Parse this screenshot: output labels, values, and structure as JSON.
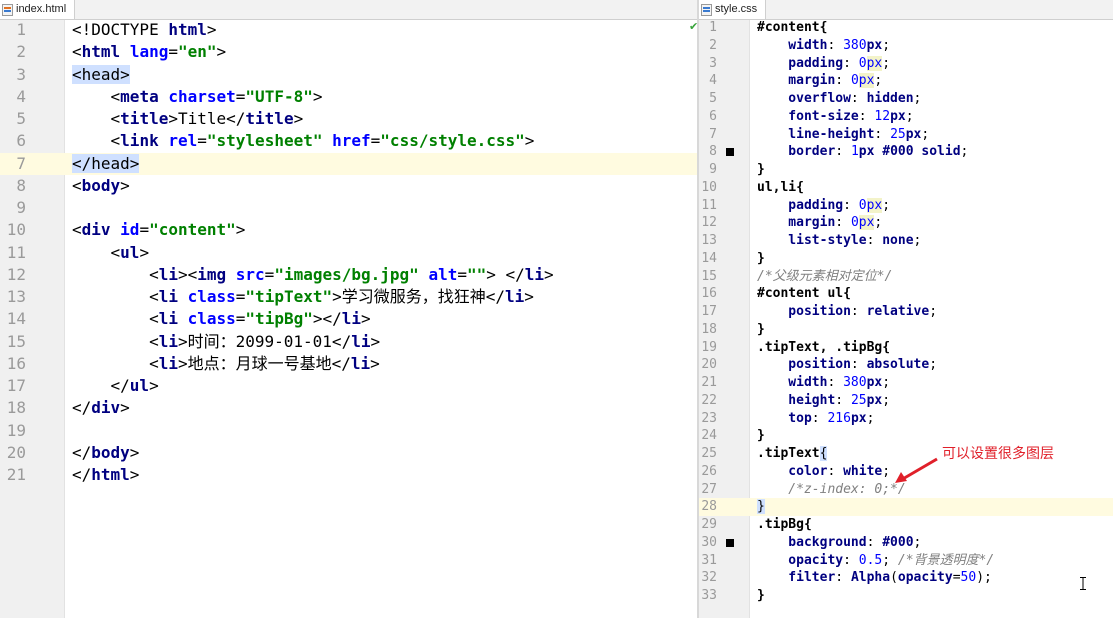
{
  "left": {
    "tab": "index.html",
    "lines": [
      {
        "n": "1",
        "s": [
          [
            "tx",
            "<!DOCTYPE "
          ],
          [
            "t",
            "html"
          ],
          [
            "tx",
            ">"
          ]
        ]
      },
      {
        "n": "2",
        "s": [
          [
            "tx",
            "<"
          ],
          [
            "t",
            "html "
          ],
          [
            "a",
            "lang"
          ],
          [
            "tx",
            "="
          ],
          [
            "v",
            "\"en\""
          ],
          [
            "tx",
            ">"
          ]
        ]
      },
      {
        "n": "3",
        "s": [
          [
            "hlt",
            "<head>"
          ]
        ]
      },
      {
        "n": "4",
        "s": [
          [
            "tx",
            "    <"
          ],
          [
            "t",
            "meta "
          ],
          [
            "a",
            "charset"
          ],
          [
            "tx",
            "="
          ],
          [
            "v",
            "\"UTF-8\""
          ],
          [
            "tx",
            ">"
          ]
        ]
      },
      {
        "n": "5",
        "s": [
          [
            "tx",
            "    <"
          ],
          [
            "t",
            "title"
          ],
          [
            "tx",
            ">Title</"
          ],
          [
            "t",
            "title"
          ],
          [
            "tx",
            ">"
          ]
        ]
      },
      {
        "n": "6",
        "s": [
          [
            "tx",
            "    <"
          ],
          [
            "t",
            "link "
          ],
          [
            "a",
            "rel"
          ],
          [
            "tx",
            "="
          ],
          [
            "v",
            "\"stylesheet\" "
          ],
          [
            "a",
            "href"
          ],
          [
            "tx",
            "="
          ],
          [
            "v",
            "\"css/style.css\""
          ],
          [
            "tx",
            ">"
          ]
        ]
      },
      {
        "n": "7",
        "s": [
          [
            "hlt",
            "</head>"
          ]
        ]
      },
      {
        "n": "8",
        "s": [
          [
            "tx",
            "<"
          ],
          [
            "t",
            "body"
          ],
          [
            "tx",
            ">"
          ]
        ]
      },
      {
        "n": "9",
        "s": []
      },
      {
        "n": "10",
        "s": [
          [
            "tx",
            "<"
          ],
          [
            "t",
            "div "
          ],
          [
            "a",
            "id"
          ],
          [
            "tx",
            "="
          ],
          [
            "v",
            "\"content\""
          ],
          [
            "tx",
            ">"
          ]
        ]
      },
      {
        "n": "11",
        "s": [
          [
            "tx",
            "    <"
          ],
          [
            "t",
            "ul"
          ],
          [
            "tx",
            ">"
          ]
        ]
      },
      {
        "n": "12",
        "s": [
          [
            "tx",
            "        <"
          ],
          [
            "t",
            "li"
          ],
          [
            "tx",
            "><"
          ],
          [
            "t",
            "img "
          ],
          [
            "a",
            "src"
          ],
          [
            "tx",
            "="
          ],
          [
            "v",
            "\"images/bg.jpg\" "
          ],
          [
            "a",
            "alt"
          ],
          [
            "tx",
            "="
          ],
          [
            "v",
            "\"\""
          ],
          [
            "tx",
            "> </"
          ],
          [
            "t",
            "li"
          ],
          [
            "tx",
            ">"
          ]
        ]
      },
      {
        "n": "13",
        "s": [
          [
            "tx",
            "        <"
          ],
          [
            "t",
            "li "
          ],
          [
            "a",
            "class"
          ],
          [
            "tx",
            "="
          ],
          [
            "v",
            "\"tipText\""
          ],
          [
            "tx",
            ">学习微服务，找狂神</"
          ],
          [
            "t",
            "li"
          ],
          [
            "tx",
            ">"
          ]
        ]
      },
      {
        "n": "14",
        "s": [
          [
            "tx",
            "        <"
          ],
          [
            "t",
            "li "
          ],
          [
            "a",
            "class"
          ],
          [
            "tx",
            "="
          ],
          [
            "v",
            "\"tipBg\""
          ],
          [
            "tx",
            "></"
          ],
          [
            "t",
            "li"
          ],
          [
            "tx",
            ">"
          ]
        ]
      },
      {
        "n": "15",
        "s": [
          [
            "tx",
            "        <"
          ],
          [
            "t",
            "li"
          ],
          [
            "tx",
            ">时间：2099-01-01</"
          ],
          [
            "t",
            "li"
          ],
          [
            "tx",
            ">"
          ]
        ]
      },
      {
        "n": "16",
        "s": [
          [
            "tx",
            "        <"
          ],
          [
            "t",
            "li"
          ],
          [
            "tx",
            ">地点：月球一号基地</"
          ],
          [
            "t",
            "li"
          ],
          [
            "tx",
            ">"
          ]
        ]
      },
      {
        "n": "17",
        "s": [
          [
            "tx",
            "    </"
          ],
          [
            "t",
            "ul"
          ],
          [
            "tx",
            ">"
          ]
        ]
      },
      {
        "n": "18",
        "s": [
          [
            "tx",
            "</"
          ],
          [
            "t",
            "div"
          ],
          [
            "tx",
            ">"
          ]
        ]
      },
      {
        "n": "19",
        "s": []
      },
      {
        "n": "20",
        "s": [
          [
            "tx",
            "</"
          ],
          [
            "t",
            "body"
          ],
          [
            "tx",
            ">"
          ]
        ]
      },
      {
        "n": "21",
        "s": [
          [
            "tx",
            "</"
          ],
          [
            "t",
            "html"
          ],
          [
            "tx",
            ">"
          ]
        ]
      }
    ]
  },
  "right": {
    "tab": "style.css",
    "lines": [
      {
        "n": "1",
        "s": [
          [
            "sel",
            "#content{"
          ]
        ]
      },
      {
        "n": "2",
        "s": [
          [
            "p",
            "    width"
          ],
          [
            "tx",
            ": "
          ],
          [
            "u",
            "380"
          ],
          [
            "p",
            "px"
          ],
          [
            "tx",
            ";"
          ]
        ]
      },
      {
        "n": "3",
        "s": [
          [
            "p",
            "    padding"
          ],
          [
            "tx",
            ": "
          ],
          [
            "u",
            "0"
          ],
          [
            "px",
            "px"
          ],
          [
            "tx",
            ";"
          ]
        ]
      },
      {
        "n": "4",
        "s": [
          [
            "p",
            "    margin"
          ],
          [
            "tx",
            ": "
          ],
          [
            "u",
            "0"
          ],
          [
            "px",
            "px"
          ],
          [
            "tx",
            ";"
          ]
        ]
      },
      {
        "n": "5",
        "s": [
          [
            "p",
            "    overflow"
          ],
          [
            "tx",
            ": "
          ],
          [
            "val",
            "hidden"
          ],
          [
            "tx",
            ";"
          ]
        ]
      },
      {
        "n": "6",
        "s": [
          [
            "p",
            "    font-size"
          ],
          [
            "tx",
            ": "
          ],
          [
            "u",
            "12"
          ],
          [
            "p",
            "px"
          ],
          [
            "tx",
            ";"
          ]
        ]
      },
      {
        "n": "7",
        "s": [
          [
            "p",
            "    line-height"
          ],
          [
            "tx",
            ": "
          ],
          [
            "u",
            "25"
          ],
          [
            "p",
            "px"
          ],
          [
            "tx",
            ";"
          ]
        ]
      },
      {
        "n": "8",
        "s": [
          [
            "p",
            "    border"
          ],
          [
            "tx",
            ": "
          ],
          [
            "u",
            "1"
          ],
          [
            "p",
            "px "
          ],
          [
            "val",
            "#000 solid"
          ],
          [
            "tx",
            ";"
          ]
        ]
      },
      {
        "n": "9",
        "s": [
          [
            "sel",
            "}"
          ]
        ]
      },
      {
        "n": "10",
        "s": [
          [
            "sel",
            "ul,li{"
          ]
        ]
      },
      {
        "n": "11",
        "s": [
          [
            "p",
            "    padding"
          ],
          [
            "tx",
            ": "
          ],
          [
            "u",
            "0"
          ],
          [
            "px",
            "px"
          ],
          [
            "tx",
            ";"
          ]
        ]
      },
      {
        "n": "12",
        "s": [
          [
            "p",
            "    margin"
          ],
          [
            "tx",
            ": "
          ],
          [
            "u",
            "0"
          ],
          [
            "px",
            "px"
          ],
          [
            "tx",
            ";"
          ]
        ]
      },
      {
        "n": "13",
        "s": [
          [
            "p",
            "    list-style"
          ],
          [
            "tx",
            ": "
          ],
          [
            "val",
            "none"
          ],
          [
            "tx",
            ";"
          ]
        ]
      },
      {
        "n": "14",
        "s": [
          [
            "sel",
            "}"
          ]
        ]
      },
      {
        "n": "15",
        "s": [
          [
            "cm",
            "/*父级元素相对定位*/"
          ]
        ]
      },
      {
        "n": "16",
        "s": [
          [
            "sel",
            "#content ul{"
          ]
        ]
      },
      {
        "n": "17",
        "s": [
          [
            "p",
            "    position"
          ],
          [
            "tx",
            ": "
          ],
          [
            "val",
            "relative"
          ],
          [
            "tx",
            ";"
          ]
        ]
      },
      {
        "n": "18",
        "s": [
          [
            "sel",
            "}"
          ]
        ]
      },
      {
        "n": "19",
        "s": [
          [
            "sel",
            ".tipText, .tipBg{"
          ]
        ]
      },
      {
        "n": "20",
        "s": [
          [
            "p",
            "    position"
          ],
          [
            "tx",
            ": "
          ],
          [
            "val",
            "absolute"
          ],
          [
            "tx",
            ";"
          ]
        ]
      },
      {
        "n": "21",
        "s": [
          [
            "p",
            "    width"
          ],
          [
            "tx",
            ": "
          ],
          [
            "u",
            "380"
          ],
          [
            "p",
            "px"
          ],
          [
            "tx",
            ";"
          ]
        ]
      },
      {
        "n": "22",
        "s": [
          [
            "p",
            "    height"
          ],
          [
            "tx",
            ": "
          ],
          [
            "u",
            "25"
          ],
          [
            "p",
            "px"
          ],
          [
            "tx",
            ";"
          ]
        ]
      },
      {
        "n": "23",
        "s": [
          [
            "p",
            "    top"
          ],
          [
            "tx",
            ": "
          ],
          [
            "u",
            "216"
          ],
          [
            "p",
            "px"
          ],
          [
            "tx",
            ";"
          ]
        ]
      },
      {
        "n": "24",
        "s": [
          [
            "sel",
            "}"
          ]
        ]
      },
      {
        "n": "25",
        "s": [
          [
            "sel",
            ".tipText"
          ],
          [
            "hlt",
            "{"
          ]
        ]
      },
      {
        "n": "26",
        "s": [
          [
            "p",
            "    color"
          ],
          [
            "tx",
            ": "
          ],
          [
            "val",
            "white"
          ],
          [
            "tx",
            ";"
          ]
        ]
      },
      {
        "n": "27",
        "s": [
          [
            "cm",
            "    /*z-index: 0;*/"
          ]
        ]
      },
      {
        "n": "28",
        "s": [
          [
            "hlt",
            "}"
          ]
        ]
      },
      {
        "n": "29",
        "s": [
          [
            "sel",
            ".tipBg{"
          ]
        ]
      },
      {
        "n": "30",
        "s": [
          [
            "p",
            "    background"
          ],
          [
            "tx",
            ": "
          ],
          [
            "val",
            "#000"
          ],
          [
            "tx",
            ";"
          ]
        ]
      },
      {
        "n": "31",
        "s": [
          [
            "p",
            "    opacity"
          ],
          [
            "tx",
            ": "
          ],
          [
            "u",
            "0.5"
          ],
          [
            "tx",
            "; "
          ],
          [
            "cm",
            "/*背景透明度*/"
          ]
        ]
      },
      {
        "n": "32",
        "s": [
          [
            "p",
            "    filter"
          ],
          [
            "tx",
            ": "
          ],
          [
            "val",
            "Alpha"
          ],
          [
            "tx",
            "("
          ],
          [
            "p",
            "opacity"
          ],
          [
            "tx",
            "="
          ],
          [
            "u",
            "50"
          ],
          [
            "tx",
            ");"
          ]
        ]
      },
      {
        "n": "33",
        "s": [
          [
            "sel",
            "}"
          ]
        ]
      }
    ]
  },
  "annotation": "可以设置很多图层",
  "colors": {
    "annotation": "#e0202a",
    "current_line": "#fffbe0",
    "tag": "#000080",
    "attr": "#0000ff",
    "string": "#008000"
  }
}
